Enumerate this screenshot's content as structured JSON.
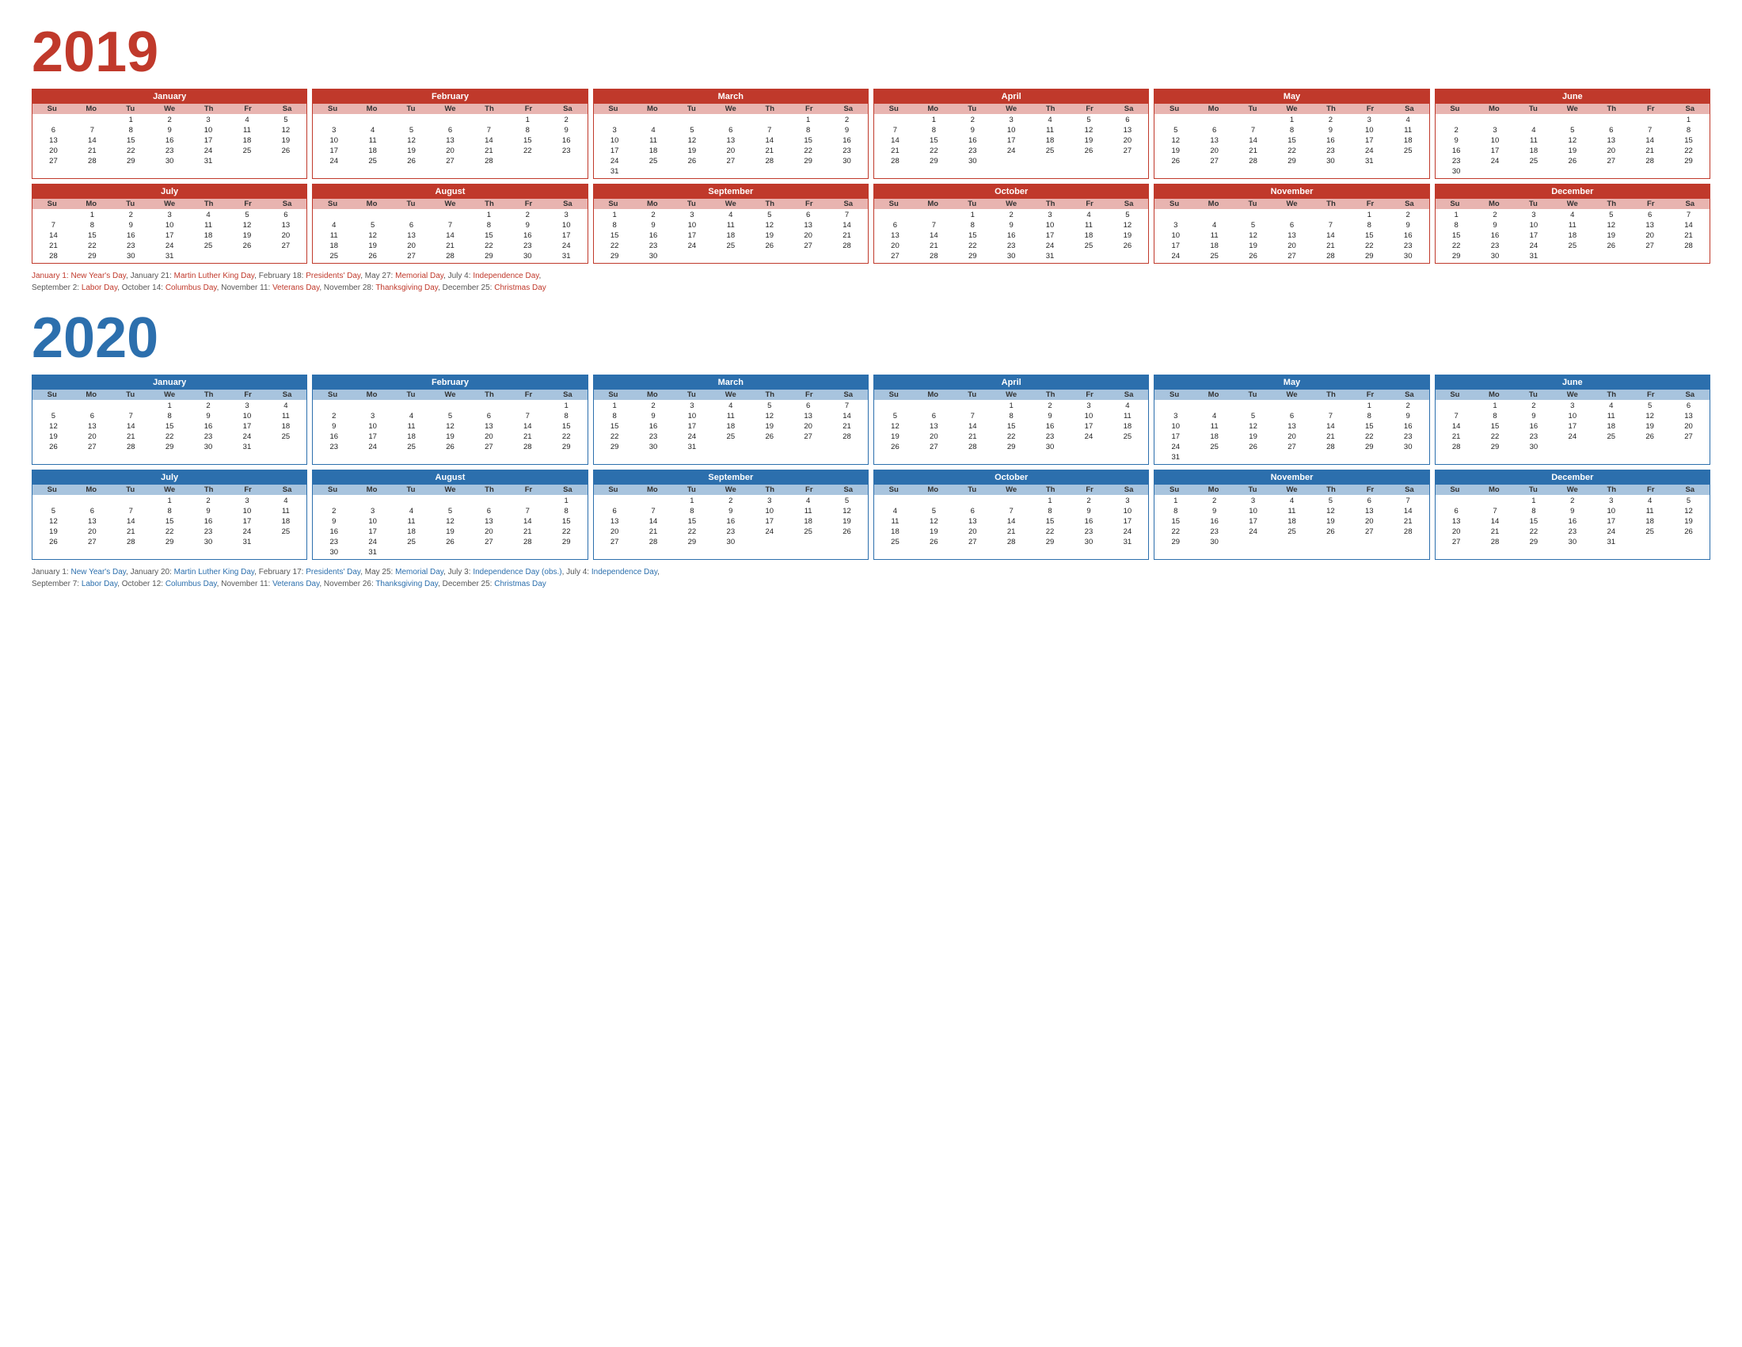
{
  "year2019": {
    "title": "2019",
    "months": [
      {
        "name": "January",
        "startDay": 2,
        "days": 31
      },
      {
        "name": "February",
        "startDay": 5,
        "days": 28
      },
      {
        "name": "March",
        "startDay": 5,
        "days": 31
      },
      {
        "name": "April",
        "startDay": 1,
        "days": 30
      },
      {
        "name": "May",
        "startDay": 3,
        "days": 31
      },
      {
        "name": "June",
        "startDay": 6,
        "days": 30
      },
      {
        "name": "July",
        "startDay": 1,
        "days": 31
      },
      {
        "name": "August",
        "startDay": 4,
        "days": 31
      },
      {
        "name": "September",
        "startDay": 0,
        "days": 30
      },
      {
        "name": "October",
        "startDay": 2,
        "days": 31
      },
      {
        "name": "November",
        "startDay": 5,
        "days": 30
      },
      {
        "name": "December",
        "startDay": 0,
        "days": 31
      }
    ],
    "holidays": "January 1: New Year's Day, January 21: Martin Luther King Day, February 18: Presidents' Day, May 27: Memorial Day, July 4: Independence Day, September 2: Labor Day, October 14: Columbus Day, November 11: Veterans Day, November 28: Thanksgiving Day, December 25: Christmas Day"
  },
  "year2020": {
    "title": "2020",
    "months": [
      {
        "name": "January",
        "startDay": 3,
        "days": 31
      },
      {
        "name": "February",
        "startDay": 6,
        "days": 29
      },
      {
        "name": "March",
        "startDay": 0,
        "days": 31
      },
      {
        "name": "April",
        "startDay": 3,
        "days": 30
      },
      {
        "name": "May",
        "startDay": 5,
        "days": 31
      },
      {
        "name": "June",
        "startDay": 1,
        "days": 30
      },
      {
        "name": "July",
        "startDay": 3,
        "days": 31
      },
      {
        "name": "August",
        "startDay": 6,
        "days": 31
      },
      {
        "name": "September",
        "startDay": 2,
        "days": 30
      },
      {
        "name": "October",
        "startDay": 4,
        "days": 31
      },
      {
        "name": "November",
        "startDay": 0,
        "days": 30
      },
      {
        "name": "December",
        "startDay": 2,
        "days": 31
      }
    ],
    "holidays": "January 1: New Year's Day, January 20: Martin Luther King Day, February 17: Presidents' Day, May 25: Memorial Day, July 3: Independence Day (obs.), July 4: Independence Day, September 7: Labor Day, October 12: Columbus Day, November 11: Veterans Day, November 26: Thanksgiving Day, December 25: Christmas Day"
  },
  "dow_labels": [
    "Su",
    "Mo",
    "Tu",
    "We",
    "Th",
    "Fr",
    "Sa"
  ]
}
